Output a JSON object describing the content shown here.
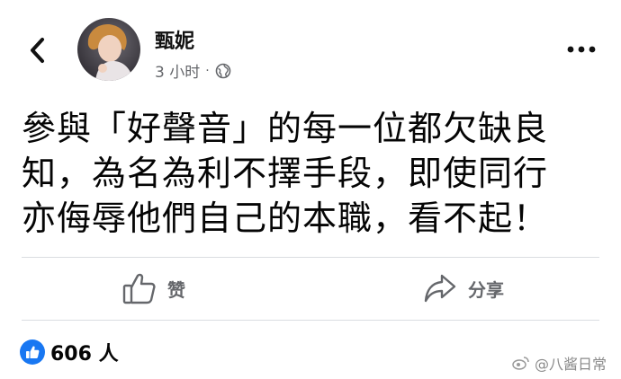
{
  "header": {
    "author_name": "甄妮",
    "timestamp": "3 小时",
    "separator": "·",
    "audience_icon": "globe-icon",
    "back_icon": "chevron-left-icon",
    "more_icon": "more-horizontal-icon"
  },
  "post": {
    "lines": [
      "參與「好聲音」的每一位都欠缺良",
      "知，為名為利不擇手段，即使同行",
      "亦侮辱他們自己的本職，看不起！"
    ]
  },
  "actions": {
    "like_label": "赞",
    "share_label": "分享"
  },
  "reactions": {
    "count": "606 人",
    "accent": "#1877f2"
  },
  "watermark": {
    "text": "@八酱日常"
  }
}
